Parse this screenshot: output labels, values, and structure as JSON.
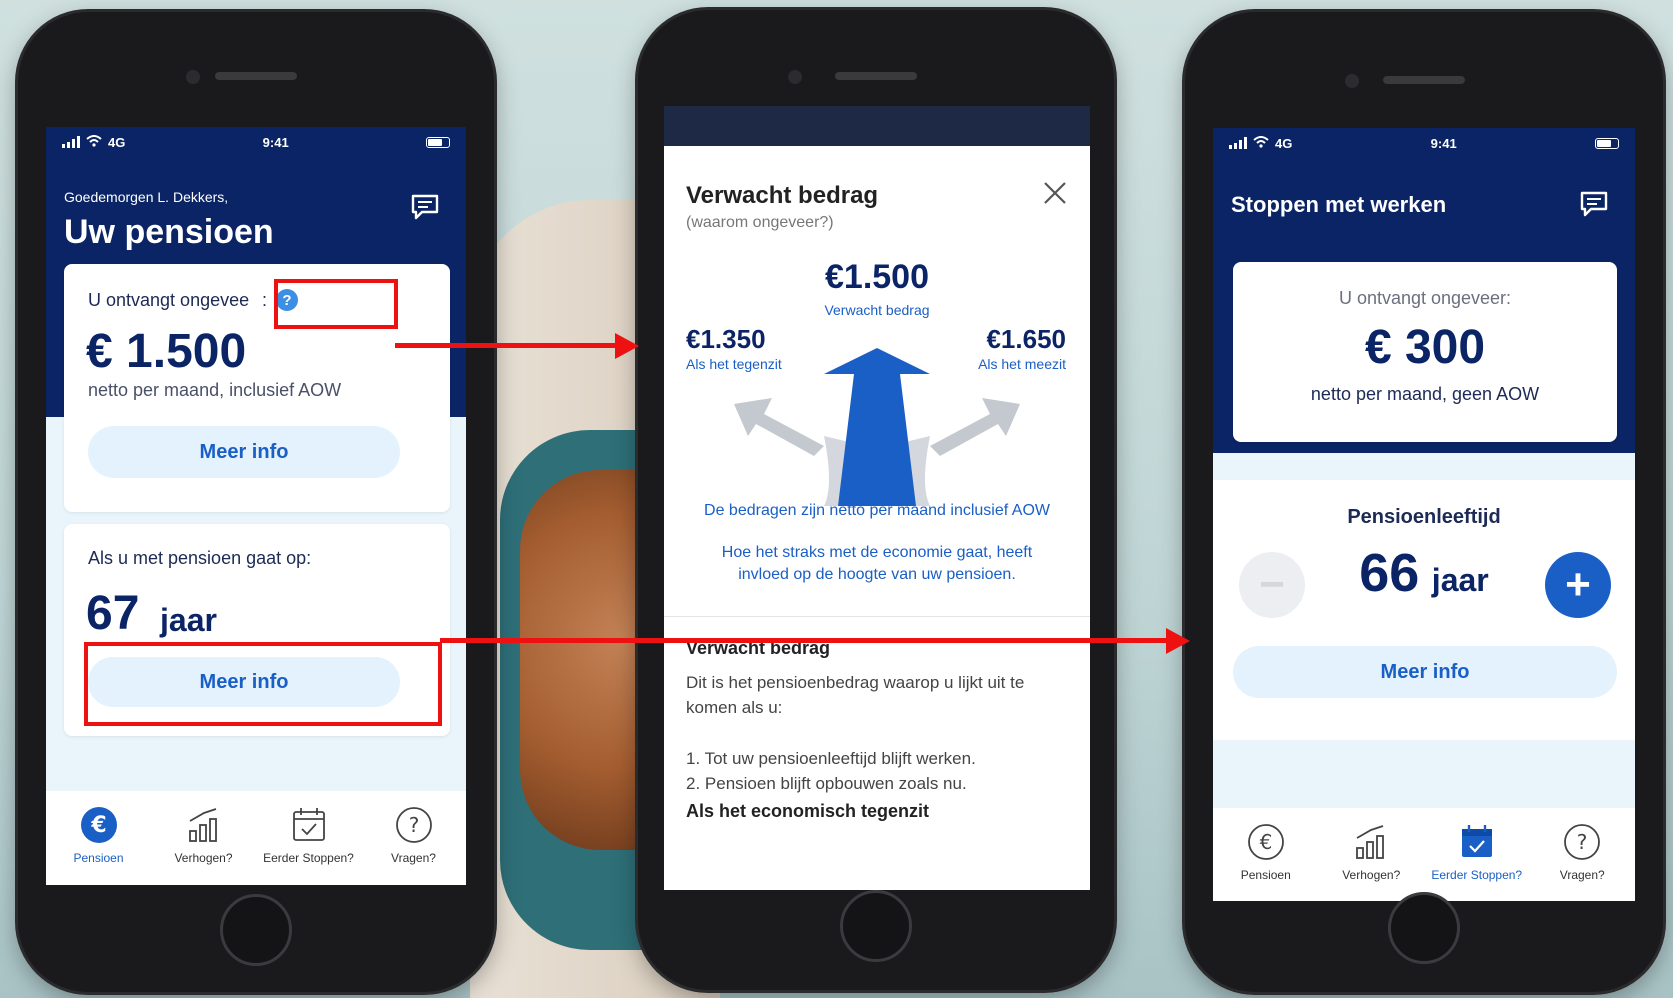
{
  "status_bar": {
    "network": "4G",
    "time": "9:41"
  },
  "screen1": {
    "greeting": "Goedemorgen L. Dekkers,",
    "title": "Uw pensioen",
    "card_income": {
      "label": "U ontvangt ongevee",
      "colon": ":",
      "help_glyph": "?",
      "amount": "€ 1.500",
      "subline": "netto per maand, inclusief AOW",
      "button": "Meer info"
    },
    "card_age": {
      "label": "Als u met pensioen gaat op:",
      "age_value": "67",
      "age_unit": "jaar",
      "button": "Meer info"
    }
  },
  "screen2": {
    "title": "Verwacht bedrag",
    "subtitle": "(waarom ongeveer?)",
    "center_amount": "€1.500",
    "center_caption": "Verwacht bedrag",
    "left_amount": "€1.350",
    "left_caption": "Als het tegenzit",
    "right_amount": "€1.650",
    "right_caption": "Als het meezit",
    "note1": "De bedragen zijn netto per maand inclusief AOW",
    "note2": "Hoe het straks met de economie gaat, heeft invloed op de hoogte van uw pensioen.",
    "section_title": "Verwacht bedrag",
    "section_body": "Dit is het pensioenbedrag waarop u lijkt uit te komen als u:",
    "list": [
      "1. Tot uw pensioenleeftijd blijft werken.",
      "2. Pensioen blijft opbouwen zoals nu."
    ],
    "section2_title": "Als het economisch tegenzit"
  },
  "screen3": {
    "title": "Stoppen met werken",
    "card_label": "U ontvangt ongeveer:",
    "amount": "€ 300",
    "subline": "netto per maand, geen AOW",
    "section_title": "Pensioenleeftijd",
    "age_value": "66",
    "age_unit": "jaar",
    "minus_glyph": "−",
    "plus_glyph": "+",
    "button": "Meer info"
  },
  "tabbar": {
    "items": [
      {
        "label": "Pensioen",
        "icon": "euro-icon"
      },
      {
        "label": "Verhogen?",
        "icon": "bar-chart-icon"
      },
      {
        "label": "Eerder Stoppen?",
        "icon": "calendar-icon"
      },
      {
        "label": "Vragen?",
        "icon": "question-icon"
      }
    ],
    "active_screen1": 0,
    "active_screen3": 2
  },
  "colors": {
    "navy": "#0b2466",
    "accent_blue": "#1a5fc6",
    "light_blue_bg": "#e9f4fb",
    "pill_bg": "#e3f2fc",
    "annotation_red": "#ee1111"
  }
}
